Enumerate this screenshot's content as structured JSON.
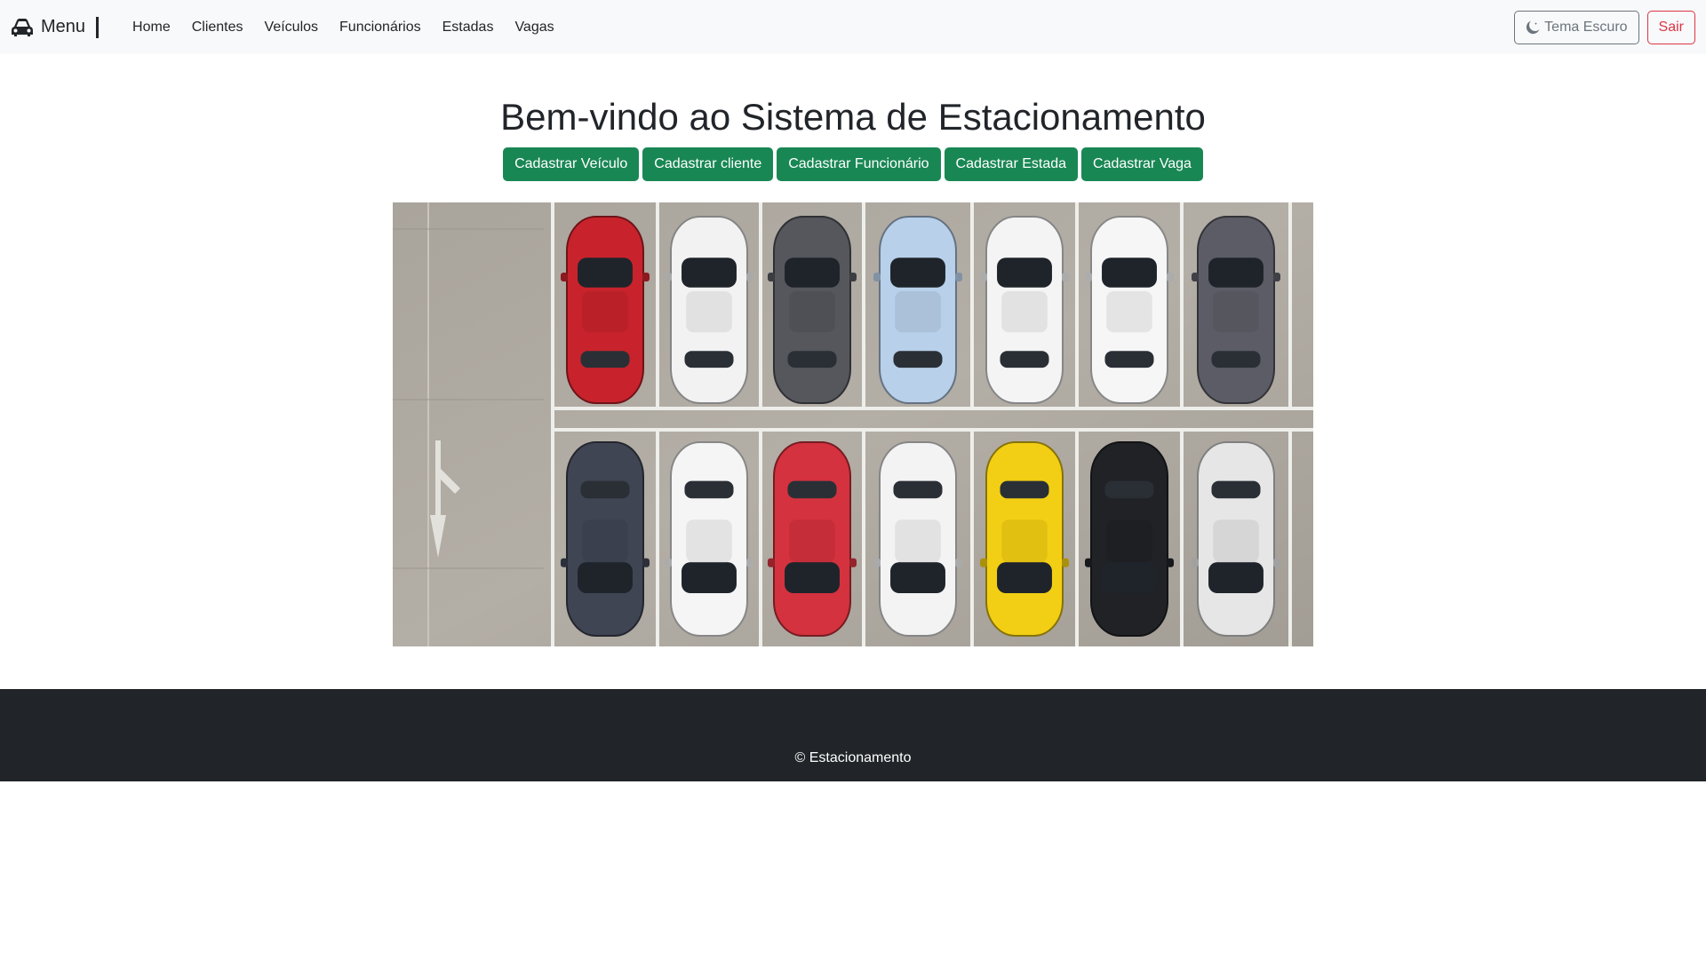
{
  "navbar": {
    "brand": "Menu",
    "brand_icon": "car-icon",
    "links": [
      "Home",
      "Clientes",
      "Veículos",
      "Funcionários",
      "Estadas",
      "Vagas"
    ],
    "theme_button": "Tema Escuro",
    "theme_icon": "moon-icon",
    "logout_button": "Sair"
  },
  "main": {
    "title": "Bem-vindo ao Sistema de Estacionamento",
    "actions": [
      "Cadastrar Veículo",
      "Cadastrar cliente",
      "Cadastrar Funcionário",
      "Cadastrar Estada",
      "Cadastrar Vaga"
    ],
    "hero_image": "aerial-parking-lot-photo",
    "hero_top_row_car_colors": [
      "#c8232c",
      "#f2f2f2",
      "#55575c",
      "#b8d0ea",
      "#f4f4f4",
      "#f6f6f6",
      "#5c5c66"
    ],
    "hero_bottom_row_car_colors": [
      "#3f4553",
      "#f5f5f5",
      "#d4323e",
      "#f3f3f3",
      "#f2cf14",
      "#202226",
      "#e6e6e6"
    ]
  },
  "footer": {
    "text": "© Estacionamento"
  },
  "colors": {
    "navbar_bg": "#f8f9fa",
    "success": "#198754",
    "danger": "#dc3545",
    "secondary": "#6c757d",
    "footer_bg": "#212529"
  }
}
